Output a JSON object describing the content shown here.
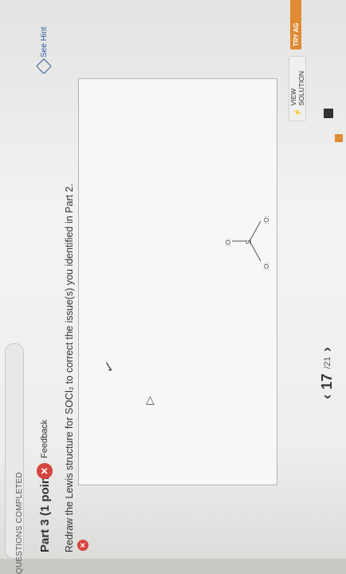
{
  "progress": {
    "label": "QUESTIONS COMPLETED"
  },
  "part": {
    "title": "Part 3  (1 point)",
    "feedback_label": "Feedback",
    "hint_label": "See Hint"
  },
  "question": {
    "text": "Redraw the Lewis structure for SOCl₂ to correct the issue(s) you identified in Part 2."
  },
  "navigation": {
    "prev_symbol": "‹",
    "next_symbol": "›",
    "current": "17",
    "total": "/21"
  },
  "actions": {
    "view_solution": "VIEW SOLUTION",
    "try_again": "TRY AG"
  },
  "molecule": {
    "central": "S",
    "top": ":O:",
    "left": ":O:",
    "right": ":O:"
  }
}
